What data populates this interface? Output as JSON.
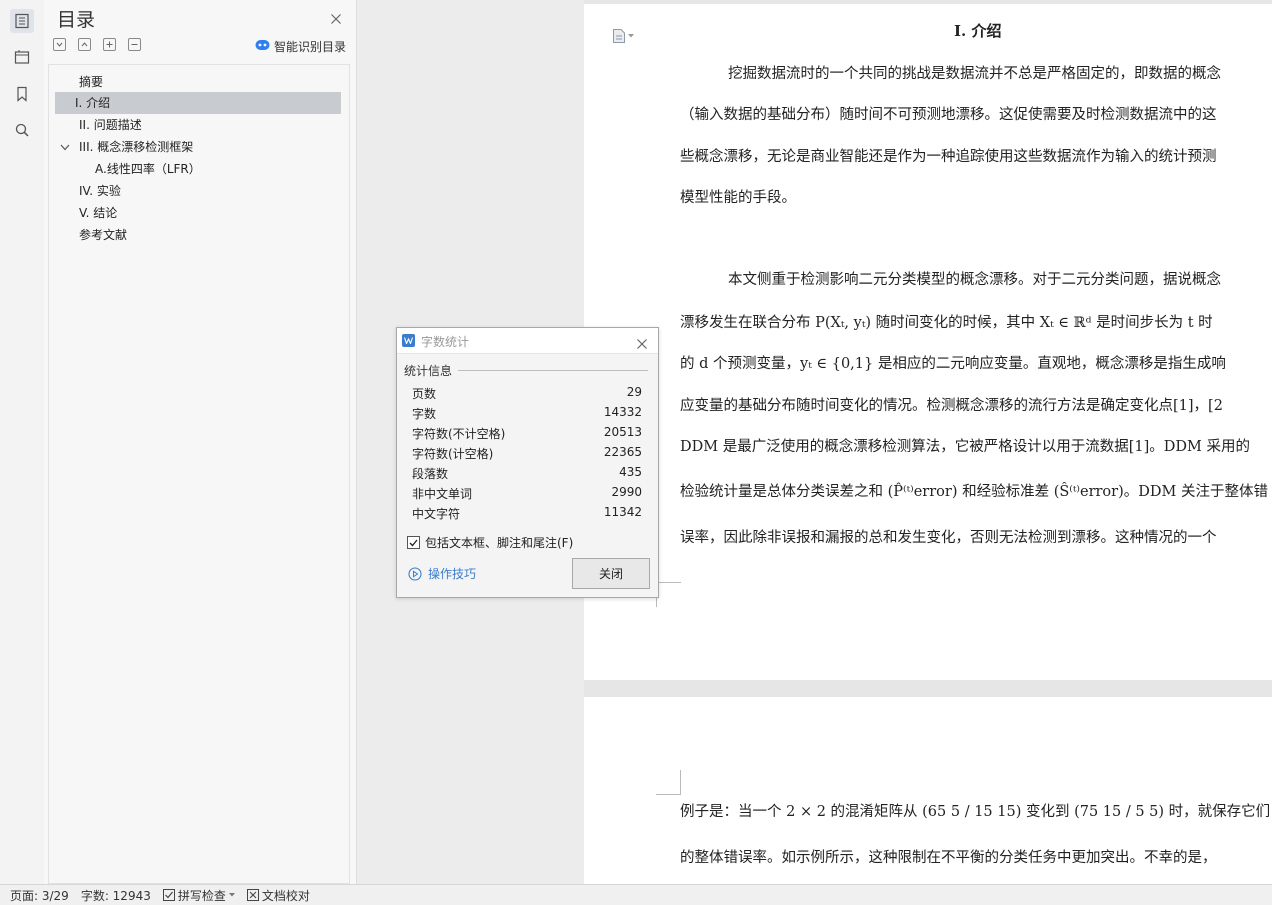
{
  "toc": {
    "title": "目录",
    "smart_label": "智能识别目录",
    "items": [
      {
        "label": "摘要"
      },
      {
        "label": "I.  介绍"
      },
      {
        "label": "II.  问题描述"
      },
      {
        "label": "III.   概念漂移检测框架"
      },
      {
        "label": "A.线性四率（LFR）"
      },
      {
        "label": "IV.  实验"
      },
      {
        "label": "V.  结论"
      },
      {
        "label": "参考文献"
      }
    ]
  },
  "document": {
    "heading": "I.  介绍",
    "page1_lines": [
      "挖掘数据流时的一个共同的挑战是数据流并不总是严格固定的，即数据的概念",
      "（输入数据的基础分布）随时间不可预测地漂移。这促使需要及时检测数据流中的这",
      "些概念漂移，无论是商业智能还是作为一种追踪使用这些数据流作为输入的统计预测",
      "模型性能的手段。",
      "本文侧重于检测影响二元分类模型的概念漂移。对于二元分类问题，据说概念",
      "漂移发生在联合分布 P(Xₜ, yₜ) 随时间变化的时候，其中 Xₜ ∈ ℝᵈ 是时间步长为 t 时",
      "的 d 个预测变量，yₜ ∈ {0,1} 是相应的二元响应变量。直观地，概念漂移是指生成响",
      "应变量的基础分布随时间变化的情况。检测概念漂移的流行方法是确定变化点[1]，[2",
      "DDM 是最广泛使用的概念漂移检测算法，它被严格设计以用于流数据[1]。DDM 采用的",
      "检验统计量是总体分类误差之和 (P̂⁽ᵗ⁾error) 和经验标准差 (Ŝ⁽ᵗ⁾error)。DDM 关注于整体错",
      "误率，因此除非误报和漏报的总和发生变化，否则无法检测到漂移。这种情况的一个"
    ],
    "page2_lines": [
      "例子是：当一个 2 × 2 的混淆矩阵从 (65 5 / 15 15) 变化到 (75 15 / 5 5) 时，就保存它们",
      "的整体错误率。如示例所示，这种限制在不平衡的分类任务中更加突出。不幸的是，"
    ]
  },
  "dialog": {
    "title": "字数统计",
    "group_label": "统计信息",
    "stats": [
      {
        "label": "页数",
        "value": "29"
      },
      {
        "label": "字数",
        "value": "14332"
      },
      {
        "label": "字符数(不计空格)",
        "value": "20513"
      },
      {
        "label": "字符数(计空格)",
        "value": "22365"
      },
      {
        "label": "段落数",
        "value": "435"
      },
      {
        "label": "非中文单词",
        "value": "2990"
      },
      {
        "label": "中文字符",
        "value": "11342"
      }
    ],
    "checkbox_label": "包括文本框、脚注和尾注(F)",
    "checkbox_checked": true,
    "tips_label": "操作技巧",
    "close_label": "关闭"
  },
  "status": {
    "page": "页面: 3/29",
    "words": "字数: 12943",
    "spell": "拼写检查",
    "proof": "文档校对"
  },
  "colors": {
    "accent": "#3b7ccf",
    "selected": "#c8ccd1",
    "smart_icon": "#2e7ff2"
  },
  "icons": [
    "toc-icon",
    "nav-pane-icon",
    "bookmark-icon",
    "search-icon",
    "close-icon",
    "collapse-all-icon",
    "expand-up-icon",
    "add-icon",
    "remove-icon",
    "ai-robot-icon",
    "wps-logo-icon",
    "play-circle-icon",
    "doc-menu-icon",
    "checkbox-icon"
  ]
}
